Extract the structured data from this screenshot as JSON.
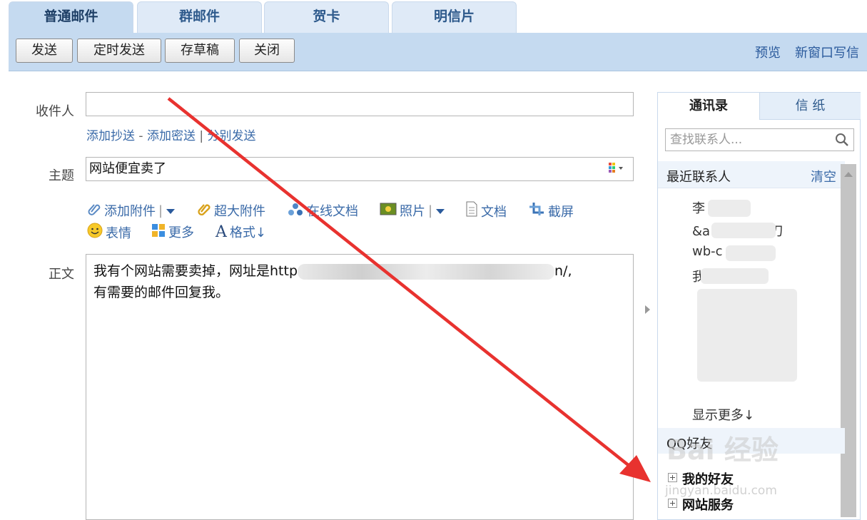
{
  "tabs": [
    "普通邮件",
    "群邮件",
    "贺卡",
    "明信片"
  ],
  "toolbar": {
    "send": "发送",
    "scheduled_send": "定时发送",
    "save_draft": "存草稿",
    "close": "关闭",
    "preview": "预览",
    "new_window": "新窗口写信"
  },
  "form": {
    "to_label": "收件人",
    "to_value": "",
    "add_cc": "添加抄送",
    "add_bcc": "添加密送",
    "separate_send": "分别发送",
    "subject_label": "主题",
    "subject_value": "网站便宜卖了",
    "body_label": "正文",
    "body_line1_prefix": "我有个网站需要卖掉，网址是http",
    "body_line1_suffix": "n/,",
    "body_line2": "有需要的邮件回复我。"
  },
  "attachments": {
    "add_attachment": "添加附件",
    "large_attachment": "超大附件",
    "online_doc": "在线文档",
    "photo": "照片",
    "document": "文档",
    "screenshot": "截屏",
    "emoji": "表情",
    "more": "更多",
    "format": "格式↓"
  },
  "panel": {
    "tab_contacts": "通讯录",
    "tab_stationery": "信 纸",
    "search_placeholder": "查找联系人...",
    "recent_title": "最近联系人",
    "clear": "清空",
    "contacts": [
      "李",
      "&a    w1561A    刀",
      "wb-c       48",
      "我       询"
    ],
    "show_more": "显示更多↓",
    "qq_friends": "QQ好友",
    "groups": [
      "我的好友",
      "网站服务"
    ]
  },
  "watermark": {
    "brand": "Bai 经验",
    "url": "jingyan.baidu.com"
  },
  "colors": {
    "toolbar_bg": "#c5daf0",
    "link": "#3a6aa8",
    "arrow": "#e8322f"
  }
}
